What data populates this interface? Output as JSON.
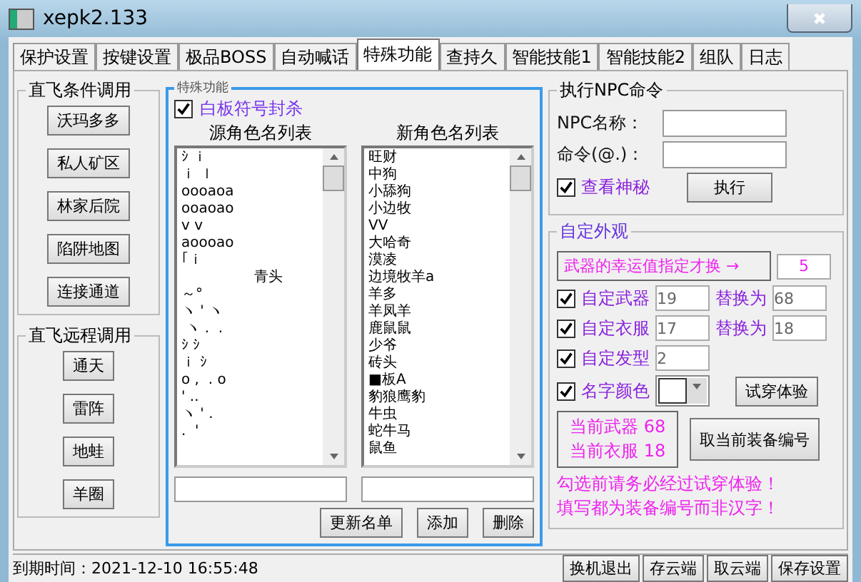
{
  "window": {
    "title": "xepk2.133"
  },
  "tabs": [
    {
      "label": "保护设置",
      "selected": false
    },
    {
      "label": "按键设置",
      "selected": false
    },
    {
      "label": "极品BOSS",
      "selected": false
    },
    {
      "label": "自动喊话",
      "selected": false
    },
    {
      "label": "特殊功能",
      "selected": true
    },
    {
      "label": "查持久",
      "selected": false
    },
    {
      "label": "智能技能1",
      "selected": false
    },
    {
      "label": "智能技能2",
      "selected": false
    },
    {
      "label": "组队",
      "selected": false
    },
    {
      "label": "日志",
      "selected": false
    }
  ],
  "left_groups": [
    {
      "title": "直飞条件调用",
      "buttons": [
        "沃玛多多",
        "私人矿区",
        "林家后院",
        "陷阱地图",
        "连接通道"
      ]
    },
    {
      "title": "直飞远程调用",
      "buttons": [
        "通天",
        "雷阵",
        "地蛙",
        "羊圈"
      ]
    }
  ],
  "special": {
    "title": "特殊功能",
    "whiteboard_kill": {
      "label": "白板符号封杀",
      "checked": true
    },
    "lists": [
      {
        "heading": "源角色名列表",
        "items": [
          "ｼ ｉ",
          "ｉ ｌ",
          "oooaoa",
          "ooaoao",
          "v v",
          "aoooao",
          "｢ｉ",
          "                青头",
          "～°",
          "ヽ ' ヽ",
          " ヽ .  .",
          "ｼ ｼ",
          "ｉ ｼ",
          "o ,  . o",
          "' ..",
          "ヽ ' .",
          ".  '"
        ]
      },
      {
        "heading": "新角色名列表",
        "items": [
          "旺财",
          "中狗",
          "小舔狗",
          "小边牧",
          "VV",
          "大哈奇",
          "漠凌",
          "边境牧羊a",
          "羊多",
          "羊凤羊",
          "鹿鼠鼠",
          "少爷",
          "砖头",
          "■板A",
          "豹狼鹰豹",
          "牛虫",
          "蛇牛马",
          "鼠鱼"
        ]
      }
    ],
    "buttons": [
      "更新名单",
      "添加",
      "删除"
    ]
  },
  "npc": {
    "title": "执行NPC命令",
    "name_label": "NPC名称：",
    "command_label": "命令(@.)：",
    "show_mystery": {
      "label": "查看神秘",
      "checked": true
    },
    "execute": "执行"
  },
  "appearance": {
    "title": "自定外观",
    "luck_note": "武器的幸运值指定才换 →",
    "luck_value": "5",
    "rows": [
      {
        "kind": "replace",
        "label": "自定武器",
        "checked": true,
        "value": "19",
        "replace_label": "替换为",
        "replace_value": "68"
      },
      {
        "kind": "replace",
        "label": "自定衣服",
        "checked": true,
        "value": "17",
        "replace_label": "替换为",
        "replace_value": "18"
      },
      {
        "kind": "single",
        "label": "自定发型",
        "checked": true,
        "value": "2"
      },
      {
        "kind": "color",
        "label": "名字颜色",
        "checked": true,
        "color": "#ffffff",
        "button": "试穿体验"
      }
    ],
    "current": [
      "当前武器 68",
      "当前衣服 18"
    ],
    "get_button": "取当前装备编号",
    "warnings": [
      "勾选前请务必经过试穿体验！",
      "填写都为装备编号而非汉字！"
    ]
  },
  "status_bar": {
    "expiry": "到期时间：2021-12-10 16:55:48",
    "buttons": [
      "换机退出",
      "存云端",
      "取云端",
      "保存设置"
    ]
  }
}
